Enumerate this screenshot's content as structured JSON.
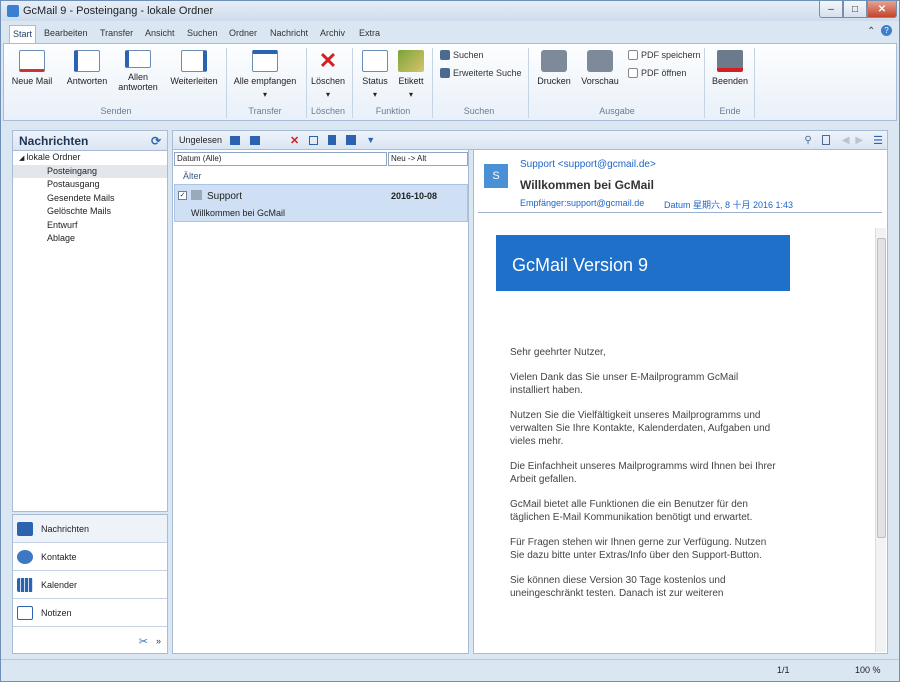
{
  "window": {
    "title": "GcMail 9 - Posteingang - lokale Ordner"
  },
  "menu": [
    "Start",
    "Bearbeiten",
    "Transfer",
    "Ansicht",
    "Suchen",
    "Ordner",
    "Nachricht",
    "Archiv",
    "Extra"
  ],
  "ribbon": {
    "senden": {
      "neue_mail": "Neue Mail",
      "antworten": "Antworten",
      "allen_antworten": "Allen antworten",
      "weiterleiten": "Weiterleiten",
      "group": "Senden"
    },
    "transfer": {
      "alle_empfangen": "Alle empfangen",
      "group": "Transfer"
    },
    "loeschen": {
      "label": "Löschen",
      "group": "Löschen"
    },
    "funktion": {
      "status": "Status",
      "etikett": "Etikett",
      "group": "Funktion"
    },
    "suchen": {
      "suchen": "Suchen",
      "erweiterte_suche": "Erweiterte Suche",
      "group": "Suchen"
    },
    "ausgabe": {
      "drucken": "Drucken",
      "vorschau": "Vorschau",
      "pdf_speichern": "PDF speichern",
      "pdf_oeffnen": "PDF öffnen",
      "group": "Ausgabe"
    },
    "ende": {
      "beenden": "Beenden",
      "group": "Ende"
    }
  },
  "sidebar": {
    "title": "Nachrichten",
    "root": "lokale Ordner",
    "folders": [
      "Posteingang",
      "Postausgang",
      "Gesendete Mails",
      "Gelöschte Mails",
      "Entwurf",
      "Ablage"
    ],
    "nav": [
      "Nachrichten",
      "Kontakte",
      "Kalender",
      "Notizen"
    ]
  },
  "list": {
    "toolbar_label": "Ungelesen",
    "filter_date": "Datum (Alle)",
    "filter_sort": "Neu -> Alt",
    "group_label": "Älter",
    "messages": [
      {
        "sender": "Support",
        "date": "2016-10-08",
        "subject": "Willkommen bei GcMail"
      }
    ]
  },
  "reader": {
    "avatar": "S",
    "from": "Support <support@gcmail.de>",
    "subject": "Willkommen bei GcMail",
    "to_line": "Empfänger:support@gcmail.de",
    "date_line": "Datum  星期六, 8  十月 2016 1:43",
    "banner": "GcMail Version 9",
    "paragraphs": [
      "Sehr geehrter Nutzer,",
      "Vielen Dank das Sie unser E-Mailprogramm GcMail installiert haben.",
      "Nutzen Sie die Vielfältigkeit unseres Mailprogramms und verwalten Sie Ihre Kontakte, Kalenderdaten, Aufgaben und vieles mehr.",
      "Die Einfachheit unseres Mailprogramms wird Ihnen bei Ihrer Arbeit gefallen.",
      "GcMail bietet alle Funktionen die ein Benutzer für den täglichen E-Mail Kommunikation benötigt und erwartet.",
      "Für Fragen stehen wir Ihnen gerne zur Verfügung. Nutzen Sie dazu bitte unter Extras/Info über den Support-Button.",
      "Sie können diese Version 30 Tage kostenlos und uneingeschränkt testen. Danach ist zur weiteren"
    ]
  },
  "status": {
    "page": "1/1",
    "zoom": "100 %"
  },
  "colors": {
    "accent": "#1e70c9",
    "delete": "#d42020"
  }
}
